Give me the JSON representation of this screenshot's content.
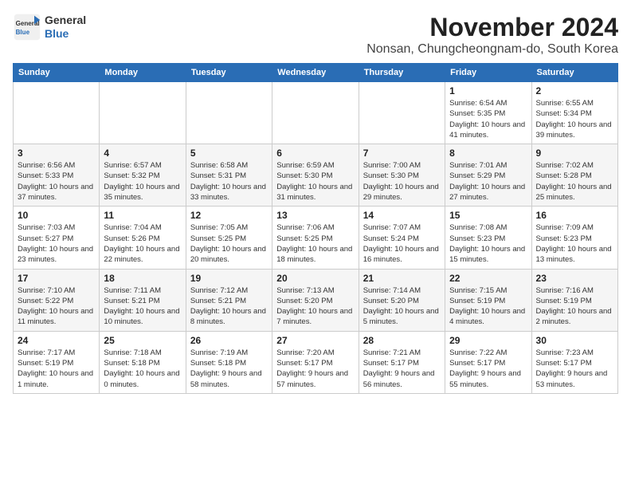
{
  "header": {
    "logo_line1": "General",
    "logo_line2": "Blue",
    "month": "November 2024",
    "location": "Nonsan, Chungcheongnam-do, South Korea"
  },
  "weekdays": [
    "Sunday",
    "Monday",
    "Tuesday",
    "Wednesday",
    "Thursday",
    "Friday",
    "Saturday"
  ],
  "weeks": [
    [
      {
        "day": "",
        "info": ""
      },
      {
        "day": "",
        "info": ""
      },
      {
        "day": "",
        "info": ""
      },
      {
        "day": "",
        "info": ""
      },
      {
        "day": "",
        "info": ""
      },
      {
        "day": "1",
        "info": "Sunrise: 6:54 AM\nSunset: 5:35 PM\nDaylight: 10 hours and 41 minutes."
      },
      {
        "day": "2",
        "info": "Sunrise: 6:55 AM\nSunset: 5:34 PM\nDaylight: 10 hours and 39 minutes."
      }
    ],
    [
      {
        "day": "3",
        "info": "Sunrise: 6:56 AM\nSunset: 5:33 PM\nDaylight: 10 hours and 37 minutes."
      },
      {
        "day": "4",
        "info": "Sunrise: 6:57 AM\nSunset: 5:32 PM\nDaylight: 10 hours and 35 minutes."
      },
      {
        "day": "5",
        "info": "Sunrise: 6:58 AM\nSunset: 5:31 PM\nDaylight: 10 hours and 33 minutes."
      },
      {
        "day": "6",
        "info": "Sunrise: 6:59 AM\nSunset: 5:30 PM\nDaylight: 10 hours and 31 minutes."
      },
      {
        "day": "7",
        "info": "Sunrise: 7:00 AM\nSunset: 5:30 PM\nDaylight: 10 hours and 29 minutes."
      },
      {
        "day": "8",
        "info": "Sunrise: 7:01 AM\nSunset: 5:29 PM\nDaylight: 10 hours and 27 minutes."
      },
      {
        "day": "9",
        "info": "Sunrise: 7:02 AM\nSunset: 5:28 PM\nDaylight: 10 hours and 25 minutes."
      }
    ],
    [
      {
        "day": "10",
        "info": "Sunrise: 7:03 AM\nSunset: 5:27 PM\nDaylight: 10 hours and 23 minutes."
      },
      {
        "day": "11",
        "info": "Sunrise: 7:04 AM\nSunset: 5:26 PM\nDaylight: 10 hours and 22 minutes."
      },
      {
        "day": "12",
        "info": "Sunrise: 7:05 AM\nSunset: 5:25 PM\nDaylight: 10 hours and 20 minutes."
      },
      {
        "day": "13",
        "info": "Sunrise: 7:06 AM\nSunset: 5:25 PM\nDaylight: 10 hours and 18 minutes."
      },
      {
        "day": "14",
        "info": "Sunrise: 7:07 AM\nSunset: 5:24 PM\nDaylight: 10 hours and 16 minutes."
      },
      {
        "day": "15",
        "info": "Sunrise: 7:08 AM\nSunset: 5:23 PM\nDaylight: 10 hours and 15 minutes."
      },
      {
        "day": "16",
        "info": "Sunrise: 7:09 AM\nSunset: 5:23 PM\nDaylight: 10 hours and 13 minutes."
      }
    ],
    [
      {
        "day": "17",
        "info": "Sunrise: 7:10 AM\nSunset: 5:22 PM\nDaylight: 10 hours and 11 minutes."
      },
      {
        "day": "18",
        "info": "Sunrise: 7:11 AM\nSunset: 5:21 PM\nDaylight: 10 hours and 10 minutes."
      },
      {
        "day": "19",
        "info": "Sunrise: 7:12 AM\nSunset: 5:21 PM\nDaylight: 10 hours and 8 minutes."
      },
      {
        "day": "20",
        "info": "Sunrise: 7:13 AM\nSunset: 5:20 PM\nDaylight: 10 hours and 7 minutes."
      },
      {
        "day": "21",
        "info": "Sunrise: 7:14 AM\nSunset: 5:20 PM\nDaylight: 10 hours and 5 minutes."
      },
      {
        "day": "22",
        "info": "Sunrise: 7:15 AM\nSunset: 5:19 PM\nDaylight: 10 hours and 4 minutes."
      },
      {
        "day": "23",
        "info": "Sunrise: 7:16 AM\nSunset: 5:19 PM\nDaylight: 10 hours and 2 minutes."
      }
    ],
    [
      {
        "day": "24",
        "info": "Sunrise: 7:17 AM\nSunset: 5:19 PM\nDaylight: 10 hours and 1 minute."
      },
      {
        "day": "25",
        "info": "Sunrise: 7:18 AM\nSunset: 5:18 PM\nDaylight: 10 hours and 0 minutes."
      },
      {
        "day": "26",
        "info": "Sunrise: 7:19 AM\nSunset: 5:18 PM\nDaylight: 9 hours and 58 minutes."
      },
      {
        "day": "27",
        "info": "Sunrise: 7:20 AM\nSunset: 5:17 PM\nDaylight: 9 hours and 57 minutes."
      },
      {
        "day": "28",
        "info": "Sunrise: 7:21 AM\nSunset: 5:17 PM\nDaylight: 9 hours and 56 minutes."
      },
      {
        "day": "29",
        "info": "Sunrise: 7:22 AM\nSunset: 5:17 PM\nDaylight: 9 hours and 55 minutes."
      },
      {
        "day": "30",
        "info": "Sunrise: 7:23 AM\nSunset: 5:17 PM\nDaylight: 9 hours and 53 minutes."
      }
    ]
  ]
}
